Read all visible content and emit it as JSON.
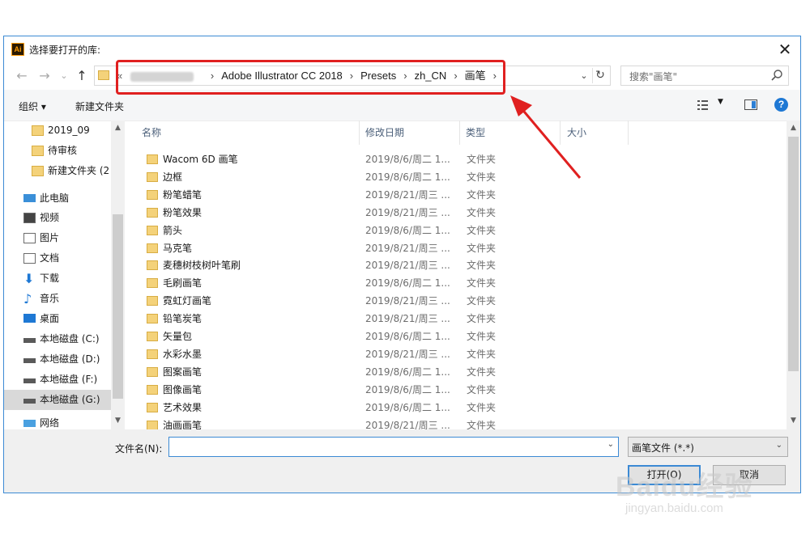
{
  "window": {
    "app_icon_text": "Ai",
    "title": "选择要打开的库:",
    "close_glyph": "✕"
  },
  "nav": {
    "back": "←",
    "forward": "→",
    "recent": "⌄",
    "up": "↑",
    "address_overflow": "«",
    "breadcrumbs": [
      "Adobe Illustrator CC 2018",
      "Presets",
      "zh_CN",
      "画笔"
    ],
    "crumb_separator": "›",
    "search_placeholder": "搜索\"画笔\""
  },
  "toolbar": {
    "organize": "组织 ▾",
    "new_folder": "新建文件夹",
    "help": "?"
  },
  "sidebar": {
    "items": [
      {
        "label": "2019_09",
        "icon": "folder-icon"
      },
      {
        "label": "待审核",
        "icon": "folder-icon"
      },
      {
        "label": "新建文件夹 (2",
        "icon": "folder-icon"
      },
      {
        "label": "此电脑",
        "icon": "computer-icon"
      },
      {
        "label": "视频",
        "icon": "video-icon"
      },
      {
        "label": "图片",
        "icon": "pictures-icon"
      },
      {
        "label": "文档",
        "icon": "documents-icon"
      },
      {
        "label": "下载",
        "icon": "download-icon"
      },
      {
        "label": "音乐",
        "icon": "music-icon"
      },
      {
        "label": "桌面",
        "icon": "desktop-icon"
      },
      {
        "label": "本地磁盘 (C:)",
        "icon": "drive-icon"
      },
      {
        "label": "本地磁盘 (D:)",
        "icon": "drive-icon"
      },
      {
        "label": "本地磁盘 (F:)",
        "icon": "drive-icon"
      },
      {
        "label": "本地磁盘 (G:)",
        "icon": "drive-icon",
        "selected": true
      },
      {
        "label": "网络",
        "icon": "network-icon"
      }
    ]
  },
  "list": {
    "columns": [
      "名称",
      "修改日期",
      "类型",
      "大小"
    ],
    "rows": [
      {
        "name": "Wacom 6D 画笔",
        "date": "2019/8/6/周二 1...",
        "type": "文件夹"
      },
      {
        "name": "边框",
        "date": "2019/8/6/周二 1...",
        "type": "文件夹"
      },
      {
        "name": "粉笔蜡笔",
        "date": "2019/8/21/周三 ...",
        "type": "文件夹"
      },
      {
        "name": "粉笔效果",
        "date": "2019/8/21/周三 ...",
        "type": "文件夹"
      },
      {
        "name": "箭头",
        "date": "2019/8/6/周二 1...",
        "type": "文件夹"
      },
      {
        "name": "马克笔",
        "date": "2019/8/21/周三 ...",
        "type": "文件夹"
      },
      {
        "name": "麦穗树枝树叶笔刷",
        "date": "2019/8/21/周三 ...",
        "type": "文件夹"
      },
      {
        "name": "毛刷画笔",
        "date": "2019/8/6/周二 1...",
        "type": "文件夹"
      },
      {
        "name": "霓虹灯画笔",
        "date": "2019/8/21/周三 ...",
        "type": "文件夹"
      },
      {
        "name": "铅笔炭笔",
        "date": "2019/8/21/周三 ...",
        "type": "文件夹"
      },
      {
        "name": "矢量包",
        "date": "2019/8/6/周二 1...",
        "type": "文件夹"
      },
      {
        "name": "水彩水墨",
        "date": "2019/8/21/周三 ...",
        "type": "文件夹"
      },
      {
        "name": "图案画笔",
        "date": "2019/8/6/周二 1...",
        "type": "文件夹"
      },
      {
        "name": "图像画笔",
        "date": "2019/8/6/周二 1...",
        "type": "文件夹"
      },
      {
        "name": "艺术效果",
        "date": "2019/8/6/周二 1...",
        "type": "文件夹"
      },
      {
        "name": "油画画笔",
        "date": "2019/8/21/周三 ...",
        "type": "文件夹"
      }
    ]
  },
  "bottom": {
    "filename_label": "文件名(N):",
    "filename_value": "",
    "filetype": "画笔文件 (*.*)",
    "open_button": "打开(O)",
    "cancel_button": "取消"
  },
  "watermark": {
    "logo": "Baidu经验",
    "sub": "jingyan.baidu.com"
  },
  "colors": {
    "highlight": "#e02020",
    "accent": "#3c8ad4",
    "folder": "#f4d27a"
  }
}
